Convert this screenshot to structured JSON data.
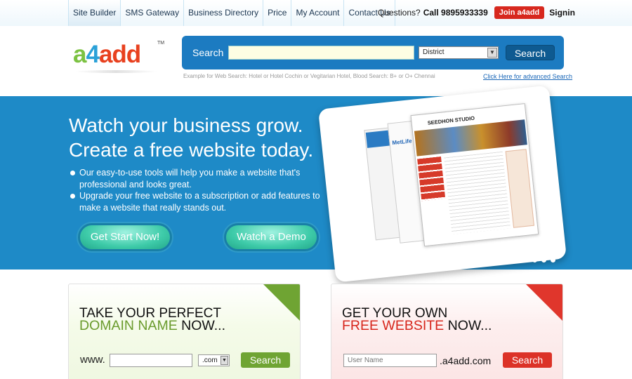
{
  "nav": {
    "items": [
      "Site Builder",
      "SMS Gateway",
      "Business Directory",
      "Price",
      "My Account",
      "Contact Us"
    ],
    "active_index": 0
  },
  "topbar": {
    "questions": "Questions?",
    "phone": "Call 9895933339",
    "join_label": "Join a4add",
    "signin_label": "Signin"
  },
  "logo": {
    "part1": "a",
    "part2": "4",
    "part3": "add",
    "tm": "TM"
  },
  "search": {
    "label": "Search",
    "input_value": "",
    "district_value": "District",
    "button_label": "Search",
    "example": "Example for Web Search: Hotel or Hotel Cochin or Vegitarian Hotel, Blood Search: B+ or O+ Chennai",
    "advanced_link": "Click Here for advanced Search"
  },
  "hero": {
    "title_line1": "Watch your business grow.",
    "title_line2": "Create a free website today.",
    "bullets": [
      "Our easy-to-use tools will help you make a website that's professional and looks great.",
      "Upgrade your free website to a subscription or add features to make a website that really stands out."
    ],
    "start_button": "Get Start Now!",
    "demo_button": "Watch a Demo",
    "preview_title": "SEEDHON STUDIO",
    "preview_brand": "MetLife",
    "slide_count": 4
  },
  "domain_card": {
    "heading1": "TAKE YOUR PERFECT",
    "highlight": "DOMAIN NAME",
    "now": " NOW...",
    "www_label": "www.",
    "input_value": "",
    "ext_value": ".com",
    "button_label": "Search",
    "ribbon_color": "#6fa433"
  },
  "free_card": {
    "heading1": "GET YOUR OWN",
    "highlight": "FREE WEBSITE",
    "now": " NOW...",
    "user_placeholder": "User Name",
    "suffix": ".a4add.com",
    "button_label": "Search",
    "ribbon_color": "#e0362c"
  },
  "colors": {
    "hero_bg": "#1e8ac7",
    "search_panel": "#1c7bc1",
    "join_red": "#d7281e",
    "cta_teal": "#3ecba9"
  }
}
